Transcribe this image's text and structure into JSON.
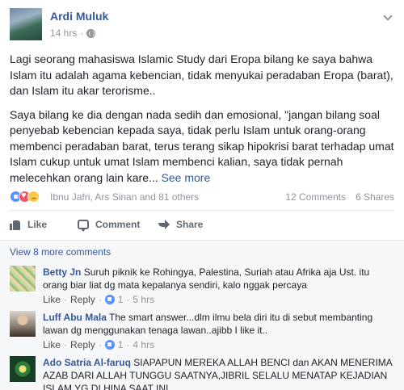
{
  "post": {
    "author": "Ardi Muluk",
    "time": "14 hrs",
    "paragraph1": "Lagi seorang mahasiswa Islamic Study dari Eropa bilang ke saya bahwa Islam itu adalah agama kebencian, tidak menyukai peradaban Eropa (barat), dan Islam itu akar terorisme..",
    "paragraph2": "Saya bilang ke dia dengan nada sedih dan emosional, \"jangan bilang soal penyebab kebencian kepada saya, tidak perlu Islam untuk orang-orang membenci peradaban barat, terus terang sikap hipokrisi barat terhadap umat Islam cukup untuk umat Islam membenci kalian, saya tidak pernah melecehkan orang lain kare...",
    "see_more": "See more",
    "reaction_names": "Ibnu Jafri, Ars Sinan and 81 others",
    "comments_count": "12 Comments",
    "shares_count": "6 Shares"
  },
  "actions": {
    "like": "Like",
    "comment": "Comment",
    "share": "Share"
  },
  "comments": {
    "view_more": "View 8 more comments",
    "items": [
      {
        "name": "Betty Jn",
        "text": "Suruh piknik ke Rohingya, Palestina, Suriah atau Afrika aja Ust. itu orang biar liat dg mata kepalanya sendiri, kalo nggak percaya",
        "like": "Like",
        "reply": "Reply",
        "likes": "1",
        "time": "5 hrs"
      },
      {
        "name": "Luff Abu Mala",
        "text": "The smart answer...dlm ilmu bela diri itu di sebut membanting lawan dg menggunakan tenaga lawan..ajibb I like it..",
        "like": "Like",
        "reply": "Reply",
        "likes": "1",
        "time": "4 hrs"
      },
      {
        "name": "Ado Satria Al-faruq",
        "text": "SIAPAPUN MEREKA ALLAH BENCI dan AKAN MENERIMA AZAB DARI ALLAH TUNGGU SAATNYA,JIBRIL SELALU MENATAP KEJADIAN ISLAM YG DI HINA SAAT INI"
      }
    ]
  }
}
